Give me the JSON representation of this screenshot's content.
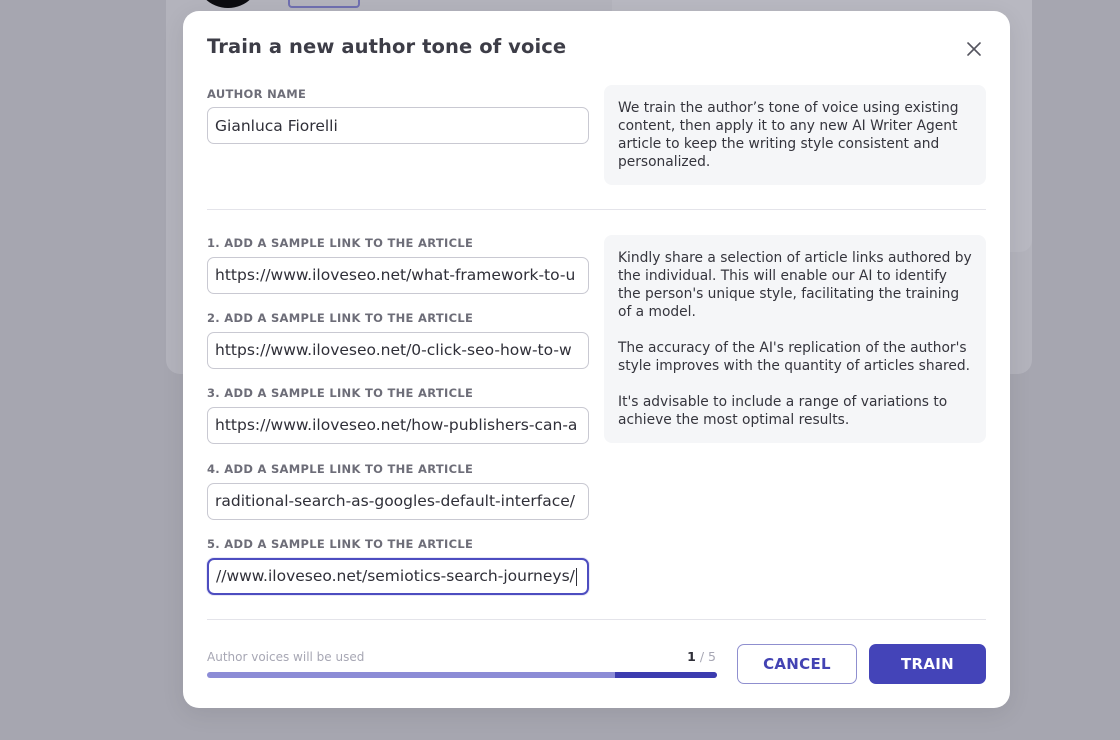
{
  "modal": {
    "title": "Train a new author tone of voice",
    "close_icon": "close-icon"
  },
  "author": {
    "label": "AUTHOR NAME",
    "value": "Gianluca Fiorelli",
    "info": "We train the author’s tone of voice using existing content, then apply it to any new AI Writer Agent article to keep the writing style consistent and personalized."
  },
  "samples": [
    {
      "label": "1. ADD A SAMPLE LINK TO THE ARTICLE",
      "value": "https://www.iloveseo.net/what-framework-to-u"
    },
    {
      "label": "2. ADD A SAMPLE LINK TO THE ARTICLE",
      "value": "https://www.iloveseo.net/0-click-seo-how-to-w"
    },
    {
      "label": "3. ADD A SAMPLE LINK TO THE ARTICLE",
      "value": "https://www.iloveseo.net/how-publishers-can-a"
    },
    {
      "label": "4. ADD A SAMPLE LINK TO THE ARTICLE",
      "value": "raditional-search-as-googles-default-interface/"
    },
    {
      "label": "5. ADD A SAMPLE LINK TO THE ARTICLE",
      "value": "//www.iloveseo.net/semiotics-search-journeys/"
    }
  ],
  "samples_info": [
    "Kindly share a selection of article links authored by the individual. This will enable our AI to identify the person's unique style, facilitating the training of a model.",
    "The accuracy of the AI's replication of the author's style improves with the quantity of articles shared.",
    "It's advisable to include a range of variations to achieve the most optimal results."
  ],
  "footer": {
    "usage_label": "Author voices will be used",
    "usage_used": "1",
    "usage_total": "/ 5",
    "usage_fraction": 0.2,
    "cancel_label": "CANCEL",
    "train_label": "TRAIN"
  },
  "colors": {
    "accent": "#4444b8",
    "progress_track": "#8c8cd6",
    "progress_fill": "#3c3caf",
    "overlay": "#a6a6b0"
  }
}
